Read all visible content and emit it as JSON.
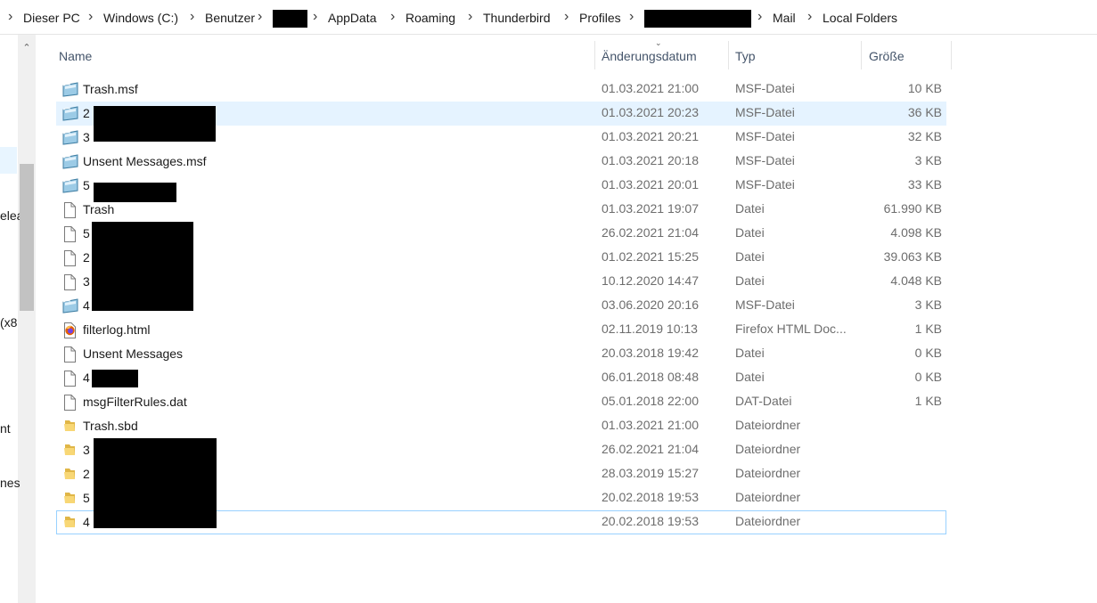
{
  "breadcrumb": [
    {
      "label": "Dieser PC"
    },
    {
      "label": "Windows (C:)"
    },
    {
      "label": "Benutzer"
    },
    {
      "label": "",
      "redacted": true
    },
    {
      "label": "AppData"
    },
    {
      "label": "Roaming"
    },
    {
      "label": "Thunderbird"
    },
    {
      "label": "Profiles"
    },
    {
      "label": "",
      "redacted": true
    },
    {
      "label": "Mail"
    },
    {
      "label": "Local Folders"
    }
  ],
  "nav_fragments": [
    "elea",
    "(x8",
    "nt",
    "nes"
  ],
  "columns": {
    "name": "Name",
    "date": "Änderungsdatum",
    "type": "Typ",
    "size": "Größe"
  },
  "files": [
    {
      "name": "Trash.msf",
      "date": "01.03.2021 21:00",
      "type": "MSF-Datei",
      "size": "10 KB",
      "icon": "msf-file-icon"
    },
    {
      "name": "2",
      "date": "01.03.2021 20:23",
      "type": "MSF-Datei",
      "size": "36 KB",
      "icon": "msf-file-icon",
      "selected": true
    },
    {
      "name": "3",
      "date": "01.03.2021 20:21",
      "type": "MSF-Datei",
      "size": "32 KB",
      "icon": "msf-file-icon"
    },
    {
      "name": "Unsent Messages.msf",
      "date": "01.03.2021 20:18",
      "type": "MSF-Datei",
      "size": "3 KB",
      "icon": "msf-file-icon"
    },
    {
      "name": "5",
      "date": "01.03.2021 20:01",
      "type": "MSF-Datei",
      "size": "33 KB",
      "icon": "msf-file-icon"
    },
    {
      "name": "Trash",
      "date": "01.03.2021 19:07",
      "type": "Datei",
      "size": "61.990 KB",
      "icon": "blank-file-icon"
    },
    {
      "name": "5",
      "date": "26.02.2021 21:04",
      "type": "Datei",
      "size": "4.098 KB",
      "icon": "blank-file-icon"
    },
    {
      "name": "2",
      "date": "01.02.2021 15:25",
      "type": "Datei",
      "size": "39.063 KB",
      "icon": "blank-file-icon"
    },
    {
      "name": "3",
      "date": "10.12.2020 14:47",
      "type": "Datei",
      "size": "4.048 KB",
      "icon": "blank-file-icon"
    },
    {
      "name": "4",
      "date": "03.06.2020 20:16",
      "type": "MSF-Datei",
      "size": "3 KB",
      "icon": "msf-file-icon"
    },
    {
      "name": "filterlog.html",
      "date": "02.11.2019 10:13",
      "type": "Firefox HTML Doc...",
      "size": "1 KB",
      "icon": "firefox-html-icon"
    },
    {
      "name": "Unsent Messages",
      "date": "20.03.2018 19:42",
      "type": "Datei",
      "size": "0 KB",
      "icon": "blank-file-icon"
    },
    {
      "name": "4",
      "date": "06.01.2018 08:48",
      "type": "Datei",
      "size": "0 KB",
      "icon": "blank-file-icon"
    },
    {
      "name": "msgFilterRules.dat",
      "date": "05.01.2018 22:00",
      "type": "DAT-Datei",
      "size": "1 KB",
      "icon": "blank-file-icon"
    },
    {
      "name": "Trash.sbd",
      "date": "01.03.2021 21:00",
      "type": "Dateiordner",
      "size": "",
      "icon": "folder-icon"
    },
    {
      "name": "3",
      "date": "26.02.2021 21:04",
      "type": "Dateiordner",
      "size": "",
      "icon": "folder-icon"
    },
    {
      "name": "2",
      "date": "28.03.2019 15:27",
      "type": "Dateiordner",
      "size": "",
      "icon": "folder-icon"
    },
    {
      "name": "5",
      "date": "20.02.2018 19:53",
      "type": "Dateiordner",
      "size": "",
      "icon": "folder-icon"
    },
    {
      "name": "4",
      "date": "20.02.2018 19:53",
      "type": "Dateiordner",
      "size": "",
      "icon": "folder-icon",
      "focused": true
    }
  ],
  "colors": {
    "selection": "#e5f3ff",
    "focus_outline": "#99d1ff",
    "header_text": "#44546a",
    "secondary_text": "#6d6d6d",
    "folder": "#f8d775"
  }
}
